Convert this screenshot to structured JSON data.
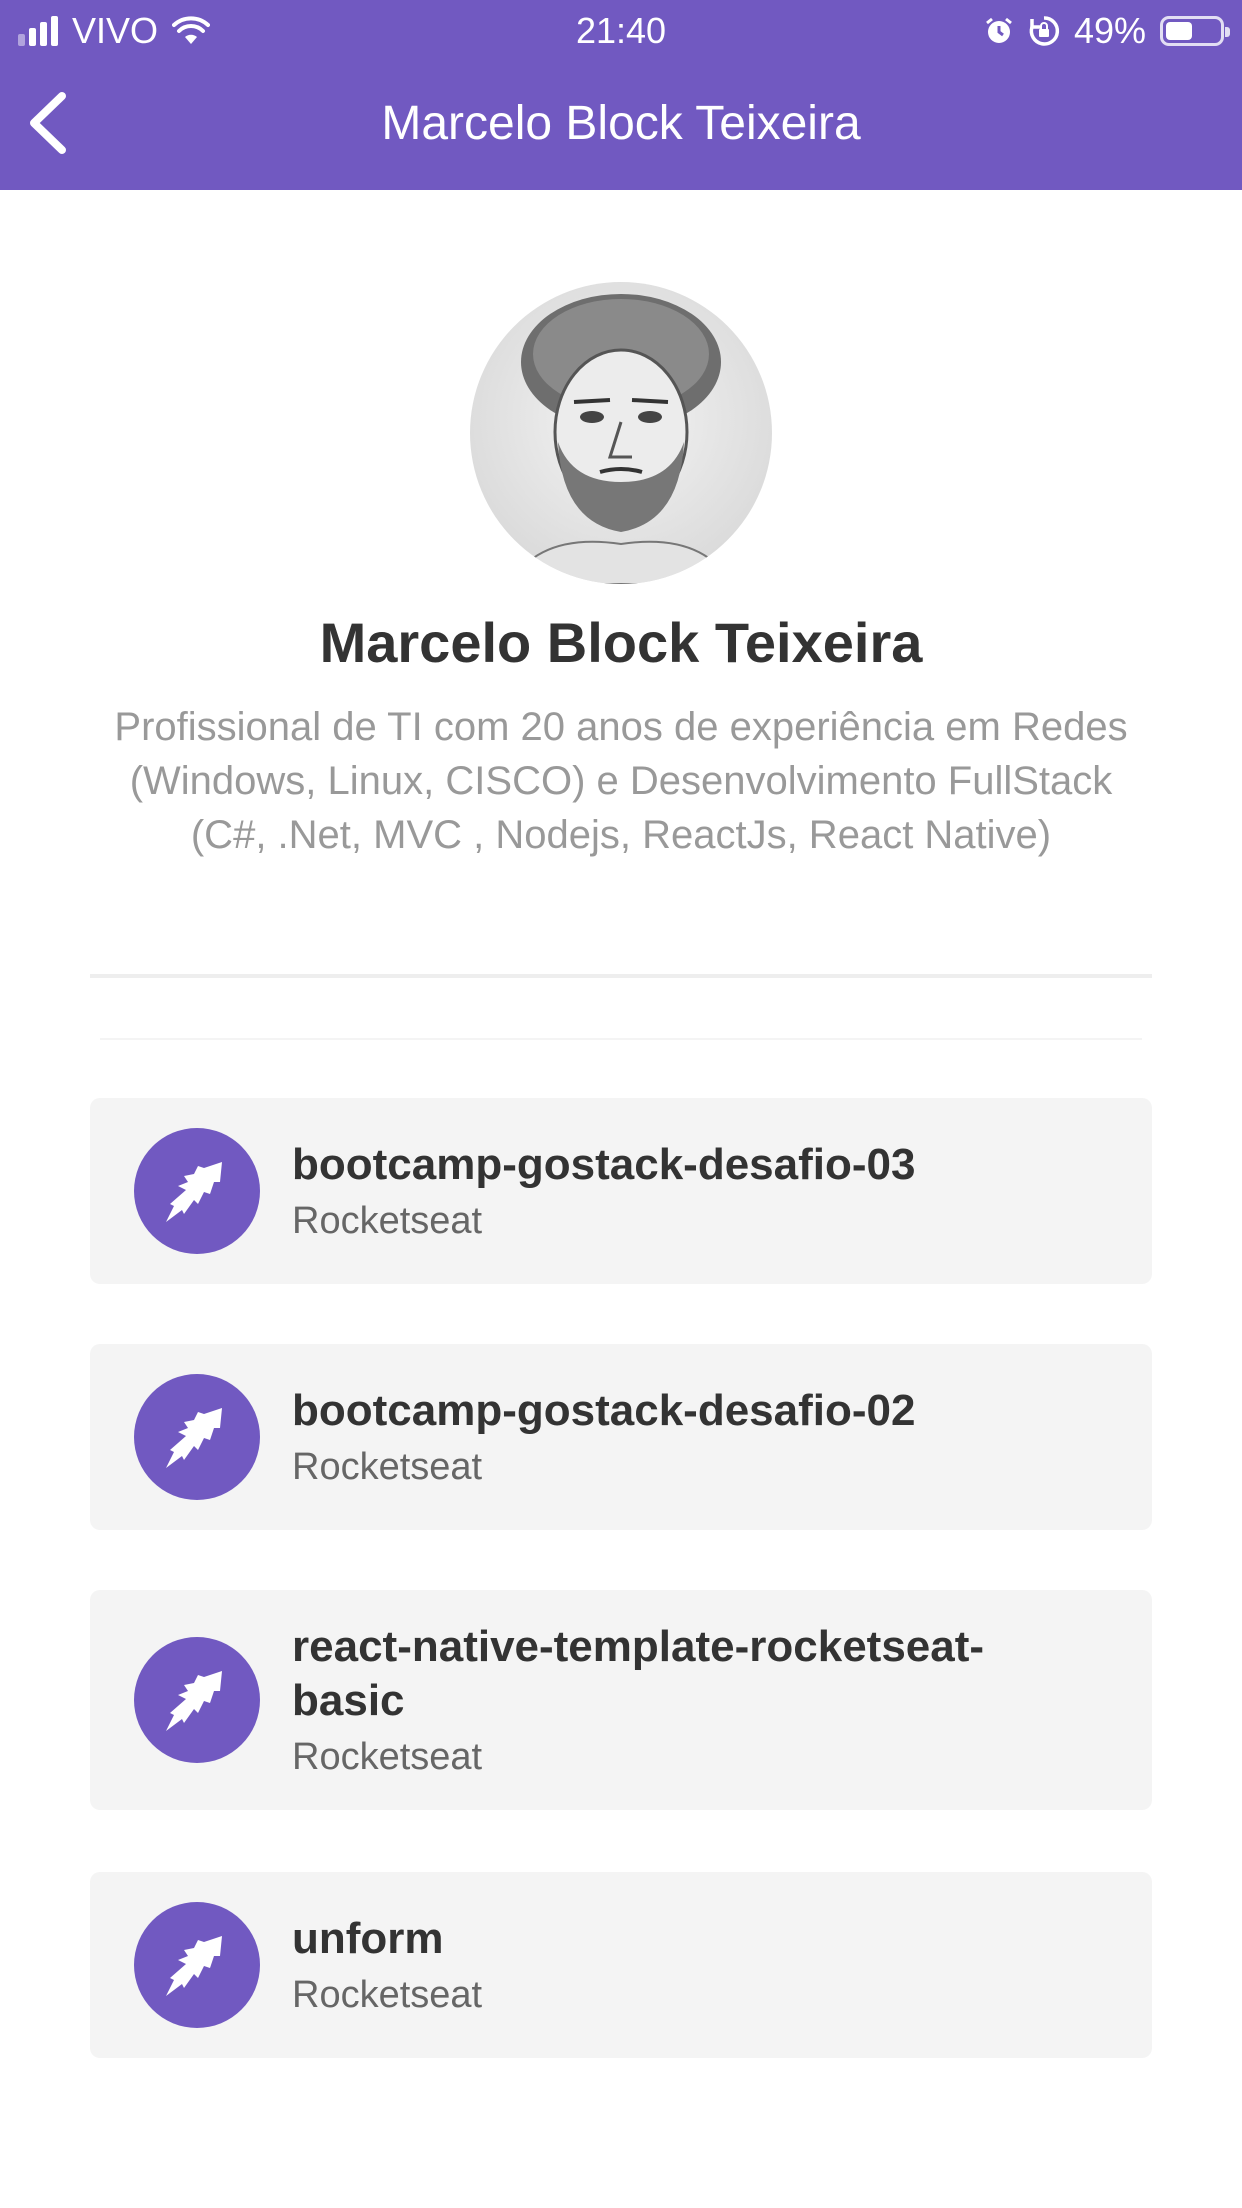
{
  "status_bar": {
    "carrier": "VIVO",
    "time": "21:40",
    "battery_percent": "49%",
    "battery_level": 0.49,
    "icons": [
      "signal-icon",
      "wifi-icon",
      "alarm-icon",
      "rotation-lock-icon",
      "battery-icon"
    ]
  },
  "header": {
    "title": "Marcelo Block Teixeira",
    "back_icon": "chevron-left-icon"
  },
  "profile": {
    "name": "Marcelo Block Teixeira",
    "bio": "Profissional de TI com 20 anos de experiência em Redes (Windows, Linux, CISCO) e Desenvolvimento FullStack (C#, .Net, MVC , Nodejs, ReactJs, React Native)"
  },
  "repos": [
    {
      "title": "bootcamp-gostack-desafio-03",
      "author": "Rocketseat",
      "icon": "rocketseat-logo-icon"
    },
    {
      "title": "bootcamp-gostack-desafio-02",
      "author": "Rocketseat",
      "icon": "rocketseat-logo-icon"
    },
    {
      "title": "react-native-template-rocketseat-basic",
      "author": "Rocketseat",
      "icon": "rocketseat-logo-icon"
    },
    {
      "title": "unform",
      "author": "Rocketseat",
      "icon": "rocketseat-logo-icon"
    }
  ],
  "colors": {
    "primary": "#7159c1",
    "card_bg": "#f4f4f4",
    "text_dark": "#333333",
    "text_muted": "#999999"
  }
}
